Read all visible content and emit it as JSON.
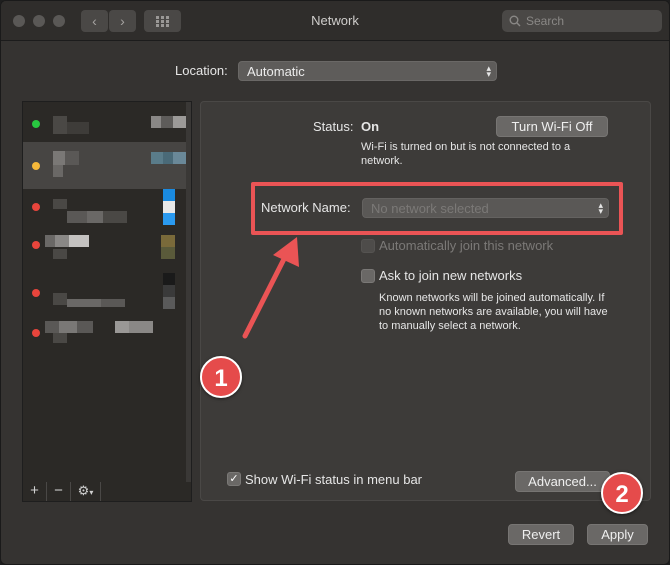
{
  "window": {
    "title": "Network",
    "search_placeholder": "Search"
  },
  "location": {
    "label": "Location:",
    "value": "Automatic"
  },
  "status": {
    "label": "Status:",
    "value": "On",
    "description": "Wi-Fi is turned on but is not connected to a network.",
    "toggle_button": "Turn Wi-Fi Off"
  },
  "network_name": {
    "label": "Network Name:",
    "placeholder": "No network selected"
  },
  "options": {
    "auto_join": "Automatically join this network",
    "ask_to_join": "Ask to join new networks",
    "ask_description": "Known networks will be joined automatically. If no known networks are available, you will have to manually select a network."
  },
  "footer": {
    "show_status": "Show Wi-Fi status in menu bar",
    "show_status_checked": true,
    "advanced_button": "Advanced...",
    "revert_button": "Revert",
    "apply_button": "Apply"
  },
  "sidebar_tools": {
    "add": "+",
    "remove": "−",
    "gear": "⚙"
  },
  "annotations": {
    "step1": "1",
    "step2": "2"
  },
  "colors": {
    "accent_red": "#ea5455",
    "status_green": "#28c840",
    "status_yellow": "#f5b83a",
    "status_red": "#e8453c"
  }
}
